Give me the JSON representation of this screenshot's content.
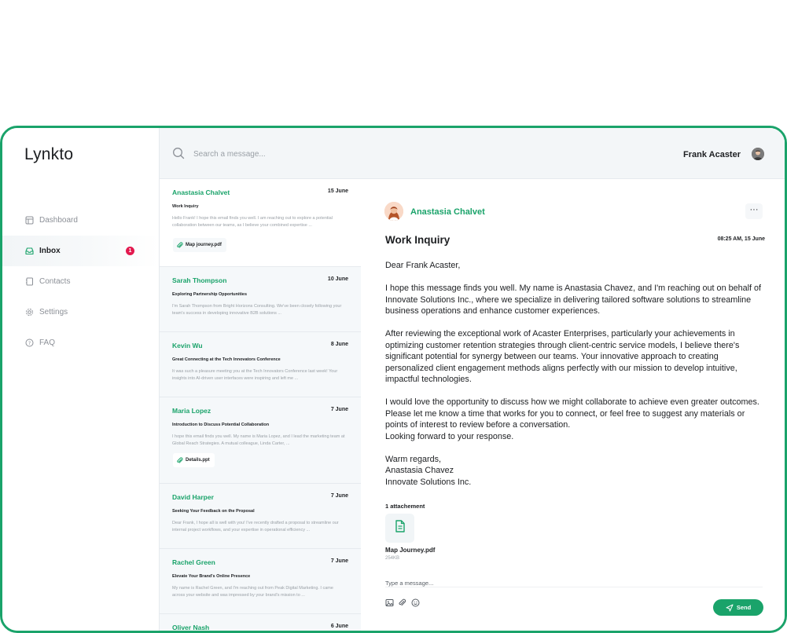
{
  "app": {
    "name": "Lynkto"
  },
  "sidebar": {
    "items": [
      {
        "label": "Dashboard",
        "icon": "dashboard-icon",
        "active": false
      },
      {
        "label": "Inbox",
        "icon": "inbox-icon",
        "active": true,
        "badge": "1"
      },
      {
        "label": "Contacts",
        "icon": "contacts-icon",
        "active": false
      },
      {
        "label": "Settings",
        "icon": "gear-icon",
        "active": false
      },
      {
        "label": "FAQ",
        "icon": "help-icon",
        "active": false
      }
    ]
  },
  "search": {
    "placeholder": "Search a message..."
  },
  "messages": [
    {
      "from": "Anastasia Chalvet",
      "date": "15 June",
      "subject": "Work Inquiry",
      "preview": "Hello Frank! I hope this email finds you well. I am reaching out to explore a potential collaboration between our teams, as I believe your combined expertise ...",
      "attachment": "Map journey.pdf"
    },
    {
      "from": "Sarah Thompson",
      "date": "10 June",
      "subject": "Exploring Partnership Opportunities",
      "preview": "I'm Sarah Thompson from Bright Horizons Consulting. We've been closely following your team's success in developing innovative B2B solutions ..."
    },
    {
      "from": "Kevin Wu",
      "date": "8 June",
      "subject": "Great Connecting at the Tech Innovators Conference",
      "preview": "It was such a pleasure meeting you at the Tech Innovators Conference last week! Your insights into AI-driven user interfaces were inspiring and left me ..."
    },
    {
      "from": "Maria Lopez",
      "date": "7 June",
      "subject": "Introduction to Discuss Potential Collaboration",
      "preview": "I hope this email finds you well. My name is Maria Lopez, and I lead the marketing team at Global Reach Strategies. A mutual colleague, Linda Carter, ...",
      "attachment": "Details.ppt"
    },
    {
      "from": "David Harper",
      "date": "7 June",
      "subject": "Seeking Your Feedback on the Proposal",
      "preview": "Dear Frank, I hope all is well with you! I've recently drafted a proposal to streamline our internal project workflows, and your expertise in operational efficiency ..."
    },
    {
      "from": "Rachel Green",
      "date": "7 June",
      "subject": "Elevate Your Brand's Online Presence",
      "preview": "My name is Rachel Green, and I'm reaching out from Peak Digital Marketing. I came across your website and was impressed by your brand's mission to ..."
    },
    {
      "from": "Oliver Nash",
      "date": "6 June"
    }
  ],
  "user": {
    "name": "Frank Acaster"
  },
  "email": {
    "sender": "Anastasia Chalvet",
    "more_label": "···",
    "title": "Work Inquiry",
    "time": "08:25 AM, 15 June",
    "greeting": "Dear Frank Acaster,",
    "paragraphs": [
      "I hope this message finds you well. My name is Anastasia Chavez, and I'm reaching out on behalf of Innovate Solutions Inc., where we specialize in delivering tailored software solutions to streamline business operations and enhance customer experiences.",
      "After reviewing the exceptional work of Acaster Enterprises, particularly your achievements in optimizing customer retention strategies through client-centric service models, I believe there's significant potential for synergy between our teams. Your innovative approach to creating personalized client engagement methods aligns perfectly with our mission to develop intuitive, impactful technologies.",
      "I would love the opportunity to discuss how we might collaborate to achieve even greater outcomes. Please let me know a time that works for you to connect, or feel free to suggest any materials or points of interest to review before a conversation."
    ],
    "closing_line": "Looking forward to your response.",
    "signoff": [
      "Warm regards,",
      "Anastasia Chavez",
      "Innovate Solutions Inc."
    ],
    "attachments_label": "1 attachement",
    "attachment": {
      "name": "Map Journey.pdf",
      "size": "254KB",
      "icon": "document-icon"
    }
  },
  "reply": {
    "placeholder": "Type a message...",
    "send_label": "Send",
    "tools": [
      "image-icon",
      "paperclip-icon",
      "emoji-icon"
    ]
  },
  "colors": {
    "accent": "#1aa36a",
    "badge": "#e3194f",
    "panel": "#f5f8fa"
  }
}
